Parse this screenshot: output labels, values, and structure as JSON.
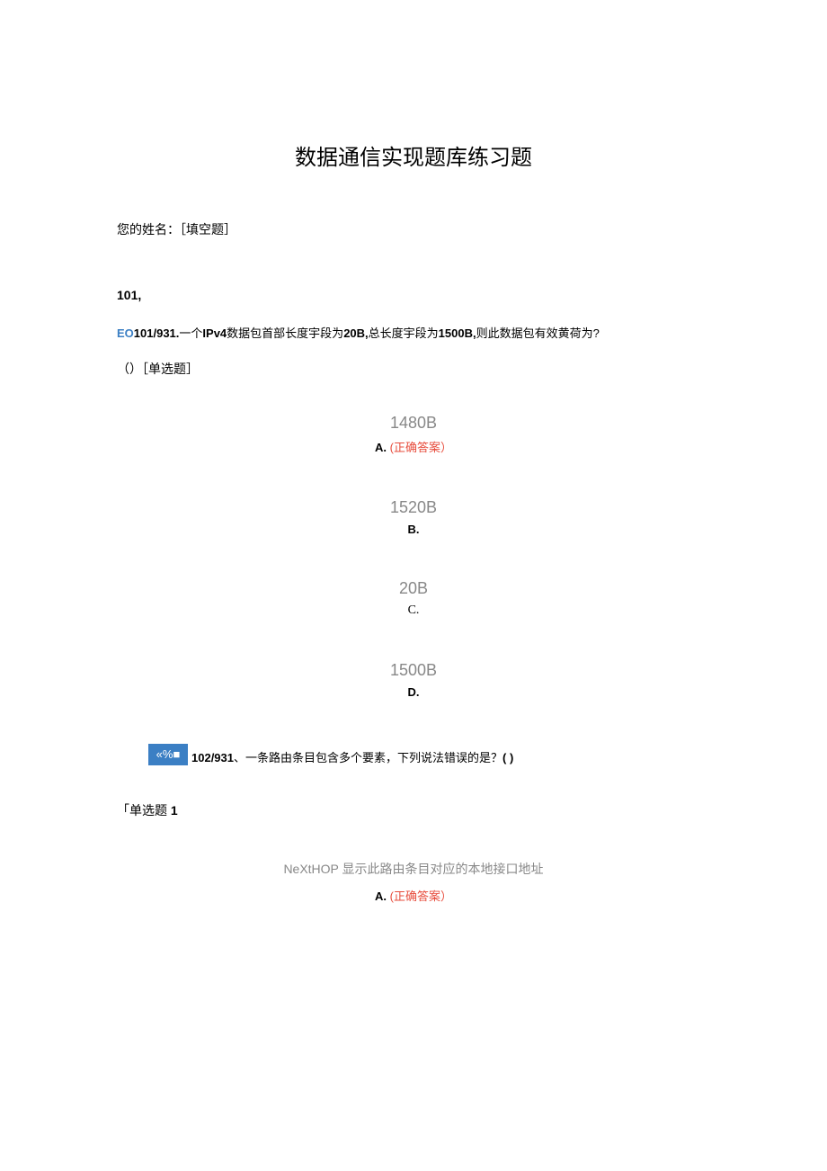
{
  "title": "数据通信实现题库练习题",
  "nameLabel": "您的姓名：［填空题］",
  "q1": {
    "num": "101,",
    "prefix": "EO",
    "idBold1": "101/931.",
    "text1": "一个",
    "bold1": "IPv4",
    "text2": "数据包首部长度宇段为",
    "bold2": "20B,",
    "text3": "总长度宇段为",
    "bold3": "1500B,",
    "text4": "则此数据包有效黄荷为?",
    "typeText": "（）［单选题］",
    "options": [
      {
        "value": "1480B",
        "label": "A.",
        "correct": "(正确答案）",
        "isCorrect": true
      },
      {
        "value": "1520B",
        "label": "B.",
        "isCorrect": false
      },
      {
        "value": "20B",
        "label": "C.",
        "isCorrect": false,
        "serif": true
      },
      {
        "value": "1500B",
        "label": "D.",
        "isCorrect": false
      }
    ]
  },
  "q2": {
    "iconText": "«%■",
    "idBold": "102/931",
    "text": "、一条路由条目包含多个要素，下列说法错误的是？",
    "paren": "( )",
    "typeText": "「单选题",
    "typeBold": "1",
    "options": [
      {
        "value": "NeXtHOP 显示此路由条目对应的本地接口地址",
        "label": "A.",
        "correct": "(正确答案）",
        "isCorrect": true
      }
    ]
  }
}
